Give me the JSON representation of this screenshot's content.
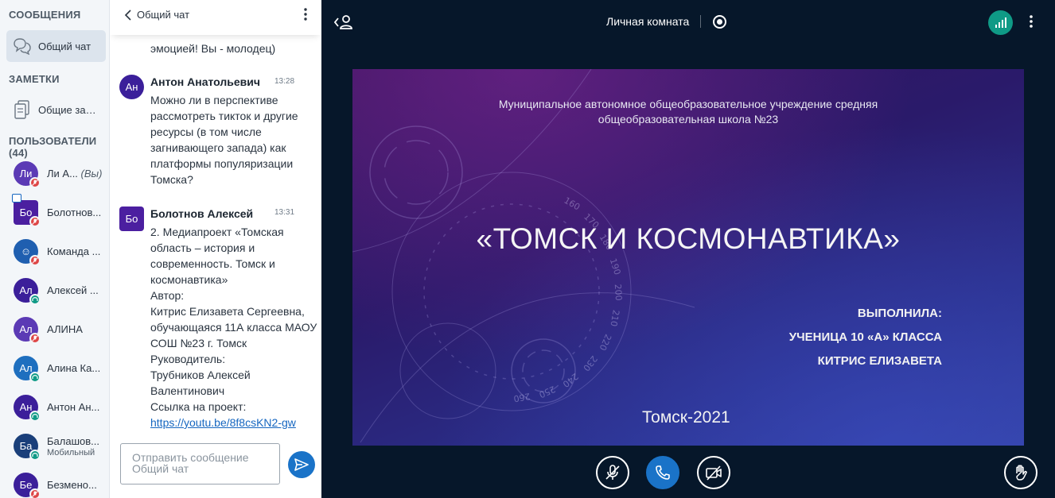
{
  "sidebar": {
    "messages_title": "СООБЩЕНИЯ",
    "public_chat": {
      "label": "Общий чат",
      "icon": "chat-bubbles-icon"
    },
    "notes_title": "ЗАМЕТКИ",
    "shared_notes": {
      "label": "Общие заметки",
      "icon": "notes-icon"
    },
    "users_title": "ПОЛЬЗОВАТЕЛИ (44)",
    "users": [
      {
        "initials": "Ли",
        "name": "Ли А...",
        "you": "(Вы)",
        "color": "#5b3ab5",
        "status": "red",
        "shape": "circle"
      },
      {
        "initials": "Бо",
        "name": "Болотнов...",
        "color": "#4b1fa0",
        "status": "red",
        "shape": "square",
        "presenter": true
      },
      {
        "initials": "☺",
        "name": "Команда ...",
        "color": "#1f5fb0",
        "status": "red",
        "shape": "circle"
      },
      {
        "initials": "Ал",
        "name": "Алексей ...",
        "color": "#3b1f9a",
        "status": "green",
        "shape": "circle"
      },
      {
        "initials": "Ал",
        "name": "АЛИНА",
        "color": "#5b3ab5",
        "status": "red",
        "shape": "circle"
      },
      {
        "initials": "Ал",
        "name": "Алина Ка...",
        "color": "#1e6fbf",
        "status": "green",
        "shape": "circle"
      },
      {
        "initials": "Ан",
        "name": "Антон Ан...",
        "color": "#3b1f9a",
        "status": "green",
        "shape": "circle"
      },
      {
        "initials": "Ба",
        "name": "Балашов...",
        "sub": "Мобильный",
        "color": "#1a3f7a",
        "status": "green",
        "shape": "circle"
      },
      {
        "initials": "Бе",
        "name": "Безмено...",
        "color": "#3b1f9a",
        "status": "red",
        "shape": "circle"
      }
    ]
  },
  "chat": {
    "title": "Общий чат",
    "cut_line": "эмоцией! Вы - молодец)",
    "messages": [
      {
        "initials": "Ан",
        "author": "Антон Анатольевич",
        "time": "13:28",
        "color": "#3b1f9a",
        "lines": [
          "Можно ли в перспективе",
          "рассмотреть тикток и другие",
          "ресурсы (в том числе",
          "загнивающего запада) как",
          "платформы популяризации",
          "Томска?"
        ]
      },
      {
        "initials": "Бо",
        "author": "Болотнов Алексей",
        "time": "13:31",
        "color": "#4b1fa0",
        "lines": [
          "2. Медиапроект «Томская",
          "область – история и",
          "современность. Томск и",
          "космонавтика»",
          "Автор:",
          "Китрис Елизавета Сергеевна,",
          "обучающаяся 11А класса МАОУ",
          "СОШ №23 г. Томск",
          "Руководитель:",
          "Трубников Алексей",
          "Валентинович",
          "Ссылка на проект:"
        ],
        "link": "https://youtu.be/8f8csKN2-gw"
      }
    ],
    "input_placeholder": "Отправить сообщение Общий чат",
    "send_icon": "send-icon"
  },
  "main": {
    "room_title": "Личная комната",
    "accent": "#1a73c8",
    "connection_color": "#0f9a86",
    "slide": {
      "school_line1": "Муниципальное автономное общеобразовательное учреждение средняя",
      "school_line2": "общеобразовательная школа №23",
      "title": "«ТОМСК И КОСМОНАВТИКА»",
      "performed_by": "ВЫПОЛНИЛА:",
      "pupil": "УЧЕНИЦА 10 «А» КЛАССА",
      "name": "КИТРИС ЕЛИЗАВЕТА",
      "city_year": "Томск-2021",
      "scale_numbers": [
        "160",
        "170",
        "180",
        "190",
        "200",
        "210",
        "220",
        "230",
        "240",
        "250",
        "260"
      ]
    },
    "controls": [
      "mic-off-icon",
      "phone-icon",
      "camera-off-icon",
      "raise-hand-icon"
    ]
  }
}
